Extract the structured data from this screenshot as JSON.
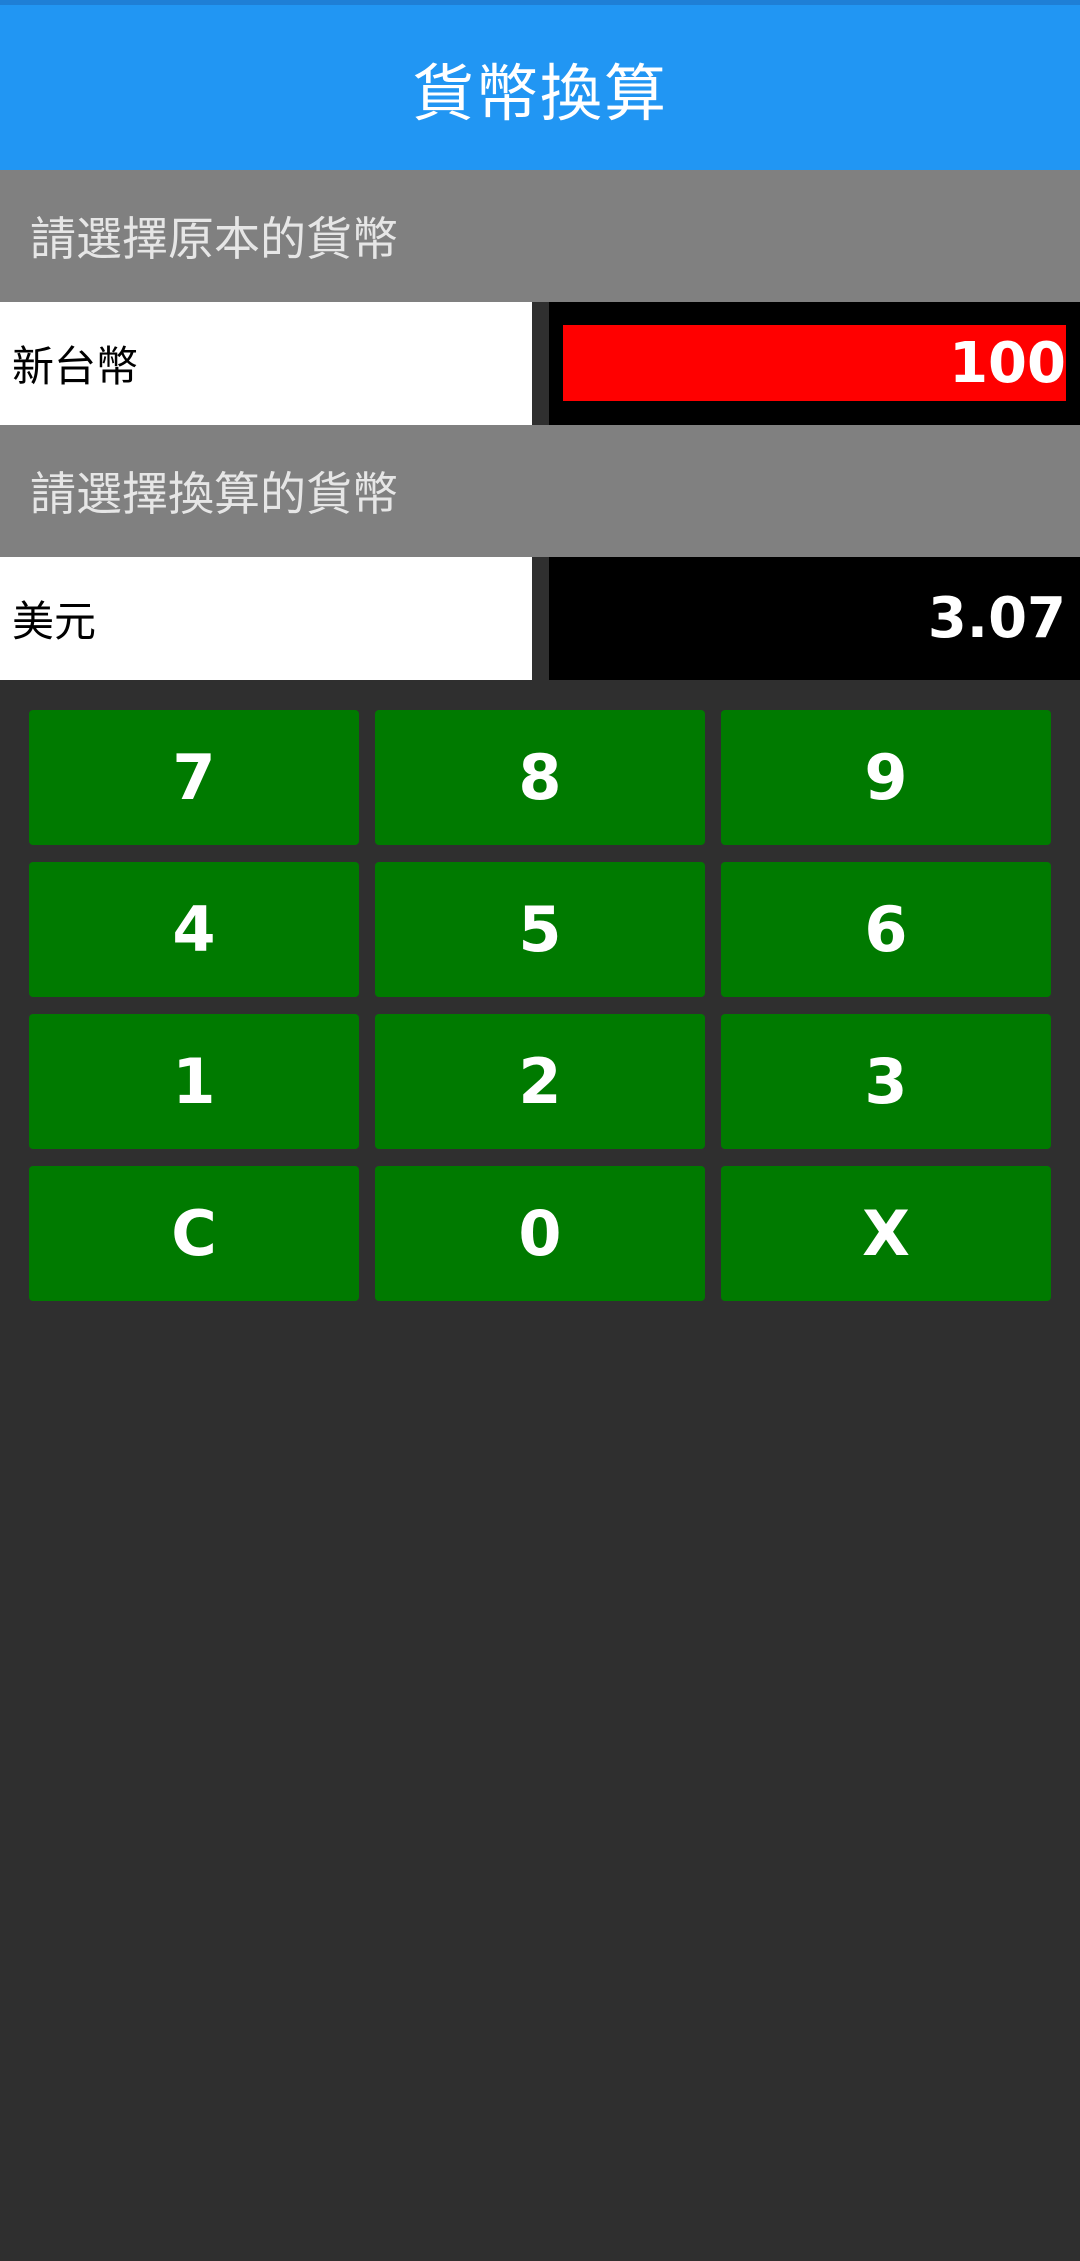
{
  "app": {
    "title": "貨幣換算"
  },
  "source": {
    "header": "請選擇原本的貨幣",
    "currency": "新台幣",
    "value": "100"
  },
  "target": {
    "header": "請選擇換算的貨幣",
    "currency": "美元",
    "value": "3.07"
  },
  "keypad": {
    "keys": [
      "7",
      "8",
      "9",
      "4",
      "5",
      "6",
      "1",
      "2",
      "3",
      "C",
      "0",
      "X"
    ]
  },
  "colors": {
    "app_bar": "#2196f3",
    "section_header": "#808080",
    "active_display": "#ff0000",
    "key": "#007a00",
    "background": "#2f2f2f"
  }
}
